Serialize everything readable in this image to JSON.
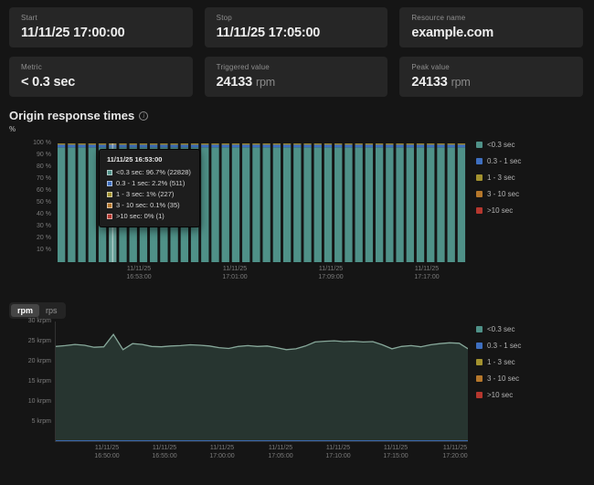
{
  "cards": [
    {
      "label": "Start",
      "value": "11/11/25 17:00:00",
      "unit": ""
    },
    {
      "label": "Stop",
      "value": "11/11/25 17:05:00",
      "unit": ""
    },
    {
      "label": "Resource name",
      "value": "example.com",
      "unit": ""
    },
    {
      "label": "Metric",
      "value": "< 0.3 sec",
      "unit": ""
    },
    {
      "label": "Triggered value",
      "value": "24133",
      "unit": "rpm"
    },
    {
      "label": "Peak value",
      "value": "24133",
      "unit": "rpm"
    }
  ],
  "section": {
    "title": "Origin response times",
    "unit_label": "%"
  },
  "legend_items": [
    {
      "label": "<0.3 sec",
      "color": "#4f9188"
    },
    {
      "label": "0.3 - 1 sec",
      "color": "#3e6fc0"
    },
    {
      "label": "1 - 3 sec",
      "color": "#a3922f"
    },
    {
      "label": "3 - 10 sec",
      "color": "#b5772b"
    },
    {
      "label": ">10 sec",
      "color": "#b5372e"
    }
  ],
  "tooltip": {
    "title": "11/11/25 16:53:00",
    "rows": [
      {
        "color": "#4f9188",
        "text": "<0.3 sec: 96.7% (22828)"
      },
      {
        "color": "#3e6fc0",
        "text": "0.3 - 1 sec: 2.2% (511)"
      },
      {
        "color": "#a3922f",
        "text": "1 - 3 sec: 1% (227)"
      },
      {
        "color": "#b5772b",
        "text": "3 - 10 sec: 0.1% (35)"
      },
      {
        "color": "#b5372e",
        "text": ">10 sec: 0% (1)"
      }
    ]
  },
  "unit_toggle": {
    "options": [
      "rpm",
      "rps"
    ],
    "selected": "rpm"
  },
  "chart_data": [
    {
      "type": "bar",
      "stacked": true,
      "title": "Origin response times",
      "ylabel": "%",
      "ylim": [
        0,
        100
      ],
      "grid": false,
      "legend_position": "right",
      "y_ticks": [
        "100 %",
        "90 %",
        "80 %",
        "70 %",
        "60 %",
        "50 %",
        "40 %",
        "30 %",
        "20 %",
        "10 %"
      ],
      "x_tick_labels": [
        [
          "11/11/25",
          "16:53:00"
        ],
        [
          "11/11/25",
          "17:01:00"
        ],
        [
          "11/11/25",
          "17:09:00"
        ],
        [
          "11/11/25",
          "17:17:00"
        ]
      ],
      "bar_count": 40,
      "hovered_bar_index": 5,
      "series_percent": [
        {
          "name": "<0.3 sec",
          "value": 96.7,
          "color": "#4f9188"
        },
        {
          "name": "0.3 - 1 sec",
          "value": 2.2,
          "color": "#3e6fc0"
        },
        {
          "name": "1 - 3 sec",
          "value": 1.0,
          "color": "#a3922f"
        },
        {
          "name": "3 - 10 sec",
          "value": 0.1,
          "color": "#b5772b"
        },
        {
          "name": ">10 sec",
          "value": 0.0,
          "color": "#b5372e"
        }
      ],
      "legend": [
        "<0.3 sec",
        "0.3 - 1 sec",
        "1 - 3 sec",
        "3 - 10 sec",
        ">10 sec"
      ]
    },
    {
      "type": "area",
      "unit": "krpm",
      "ylim": [
        0,
        30
      ],
      "grid": false,
      "legend_position": "right",
      "y_ticks": [
        "30 krpm",
        "25 krpm",
        "20 krpm",
        "15 krpm",
        "10 krpm",
        "5 krpm"
      ],
      "x_tick_labels": [
        [
          "11/11/25",
          "16:50:00"
        ],
        [
          "11/11/25",
          "16:55:00"
        ],
        [
          "11/11/25",
          "17:00:00"
        ],
        [
          "11/11/25",
          "17:05:00"
        ],
        [
          "11/11/25",
          "17:10:00"
        ],
        [
          "11/11/25",
          "17:15:00"
        ],
        [
          "11/11/25",
          "17:20:00"
        ]
      ],
      "series": [
        {
          "name": "<0.3 sec",
          "color": "#87a89a",
          "fill": "#273530",
          "values": [
            23.8,
            24.0,
            24.3,
            24.1,
            23.6,
            23.7,
            26.8,
            23.0,
            24.5,
            24.3,
            23.8,
            23.7,
            23.9,
            24.0,
            24.2,
            24.1,
            23.9,
            23.5,
            23.3,
            23.8,
            24.0,
            23.8,
            23.9,
            23.5,
            23.0,
            23.2,
            23.9,
            24.9,
            25.1,
            25.2,
            25.0,
            25.1,
            24.9,
            25.0,
            24.2,
            23.2,
            23.8,
            24.0,
            23.7,
            24.2,
            24.5,
            24.7,
            24.6,
            23.1
          ]
        },
        {
          "name": "0.3 - 1 sec",
          "color": "#3e6fc0",
          "fill": "none",
          "values": [
            0.3,
            0.3,
            0.3,
            0.3,
            0.3,
            0.3,
            0.3,
            0.3,
            0.3,
            0.3,
            0.3,
            0.3,
            0.3,
            0.3,
            0.3,
            0.3,
            0.3,
            0.3,
            0.3,
            0.3,
            0.3,
            0.3,
            0.3,
            0.3,
            0.3,
            0.3,
            0.3,
            0.3,
            0.3,
            0.3,
            0.3,
            0.3,
            0.3,
            0.3,
            0.3,
            0.3,
            0.3,
            0.3,
            0.3,
            0.3,
            0.3,
            0.3,
            0.3,
            0.3
          ]
        }
      ],
      "legend": [
        "<0.3 sec",
        "0.3 - 1 sec",
        "1 - 3 sec",
        "3 - 10 sec",
        ">10 sec"
      ]
    }
  ]
}
